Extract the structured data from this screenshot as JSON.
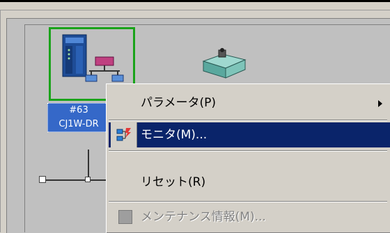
{
  "canvas": {
    "node": {
      "address": "#63",
      "model": "CJ1W-DR"
    }
  },
  "context_menu": {
    "items": [
      {
        "label": "パラメータ(P)",
        "has_submenu": true,
        "state": "normal"
      },
      {
        "label": "モニタ(M)...",
        "icon": "monitor-icon",
        "state": "selected"
      },
      {
        "label": "リセット(R)",
        "state": "normal"
      },
      {
        "label": "メンテナンス情報(M)...",
        "icon": "maintenance-icon",
        "state": "disabled"
      }
    ]
  },
  "colors": {
    "selection": "#0a246a",
    "node_label_bg": "#3568c8",
    "device_frame": "#1aa31a",
    "menu_bg": "#d4d0c8"
  }
}
